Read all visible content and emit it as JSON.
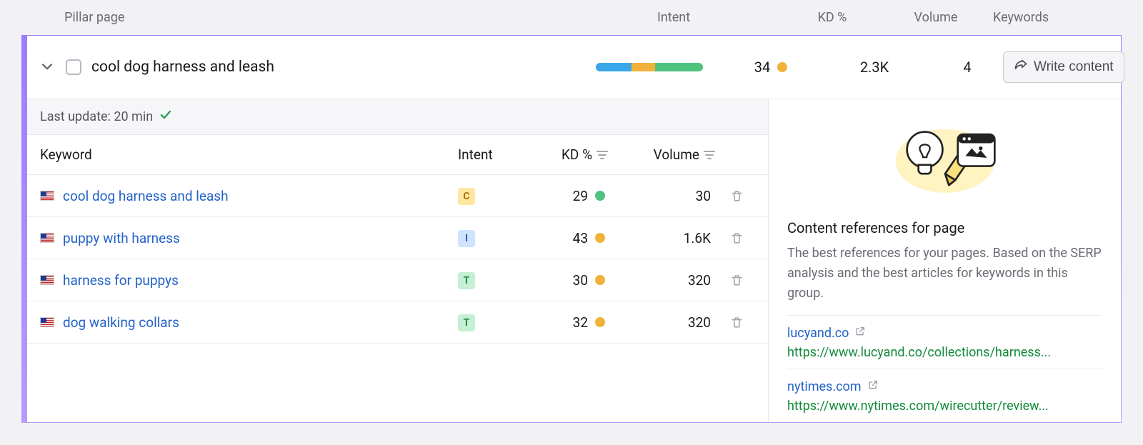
{
  "columns": {
    "pillar": "Pillar page",
    "intent": "Intent",
    "kd": "KD %",
    "volume": "Volume",
    "keywords": "Keywords"
  },
  "summary": {
    "title": "cool dog harness and leash",
    "kd": "34",
    "kd_color": "orange",
    "volume": "2.3K",
    "keyword_count": "4",
    "intent_bar": [
      {
        "color": "#3aa6ea",
        "pct": 33
      },
      {
        "color": "#f2b23a",
        "pct": 22
      },
      {
        "color": "#4fc27d",
        "pct": 45
      }
    ],
    "write_label": "Write content"
  },
  "last_update_label": "Last update: 20 min",
  "inner_headers": {
    "keyword": "Keyword",
    "intent": "Intent",
    "kd": "KD %",
    "volume": "Volume"
  },
  "rows": [
    {
      "flag": "us",
      "keyword": "cool dog harness and leash",
      "intent": "C",
      "kd": "29",
      "kd_color": "green",
      "volume": "30"
    },
    {
      "flag": "us",
      "keyword": "puppy with harness",
      "intent": "I",
      "kd": "43",
      "kd_color": "orange",
      "volume": "1.6K"
    },
    {
      "flag": "us",
      "keyword": "harness for puppys",
      "intent": "T",
      "kd": "30",
      "kd_color": "orange",
      "volume": "320"
    },
    {
      "flag": "us",
      "keyword": "dog walking collars",
      "intent": "T",
      "kd": "32",
      "kd_color": "orange",
      "volume": "320"
    }
  ],
  "sidebar": {
    "title": "Content references for page",
    "desc": "The best references for your pages. Based on the SERP analysis and the best articles for keywords in this group.",
    "refs": [
      {
        "domain": "lucyand.co",
        "url": "https://www.lucyand.co/collections/harness..."
      },
      {
        "domain": "nytimes.com",
        "url": "https://www.nytimes.com/wirecutter/review..."
      }
    ]
  }
}
